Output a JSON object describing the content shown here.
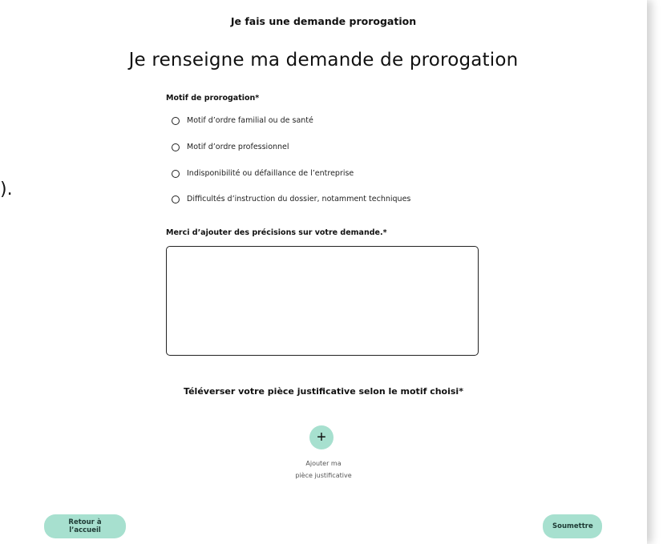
{
  "header": {
    "title": "Je fais une demande prorogation"
  },
  "stray_char": ").",
  "form": {
    "heading": "Je renseigne ma demande de prorogation",
    "motif_label": "Motif de prorogation*",
    "motifs": [
      "Motif d’ordre familial ou de santé",
      "Motif d’ordre professionnel",
      "Indisponibilité ou défaillance de l’entreprise",
      "Difficultés d’instruction du dossier, notamment techniques"
    ],
    "precisions_label": "Merci d’ajouter des précisions sur votre demande.*",
    "precisions_value": "",
    "upload_label": "Téléverser votre pièce justificative selon le motif choisi*",
    "upload_button_glyph": "+",
    "upload_caption_line1": "Ajouter ma",
    "upload_caption_line2": "pièce justificative"
  },
  "footer": {
    "back_label": "Retour à l’accueil",
    "submit_label": "Soumettre"
  },
  "colors": {
    "accent": "#a7e0cf",
    "text": "#111111"
  }
}
